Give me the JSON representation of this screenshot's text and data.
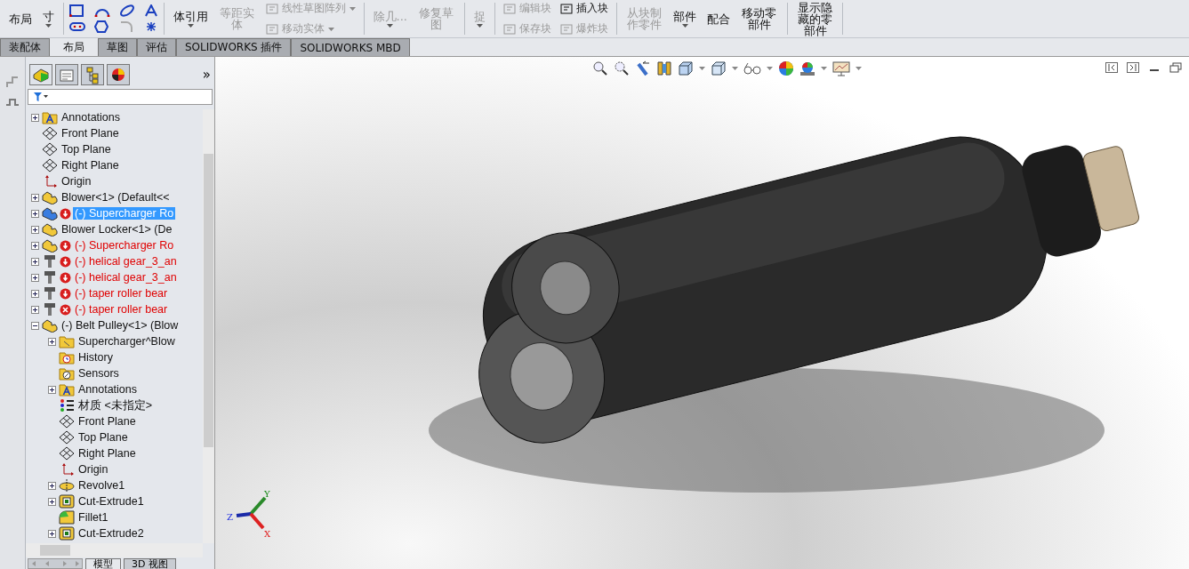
{
  "ribbon": {
    "groups": [
      {
        "items": [
          {
            "kind": "large",
            "label": "布局",
            "disabled": false,
            "dropdown": false
          },
          {
            "kind": "large",
            "label": "寸",
            "disabled": false,
            "dropdown": true
          }
        ]
      },
      {
        "items": [
          {
            "kind": "sketch-icons"
          }
        ]
      },
      {
        "items": [
          {
            "kind": "large",
            "label": "体引用",
            "disabled": false,
            "dropdown": true
          },
          {
            "kind": "large",
            "label": "等距实体",
            "disabled": true,
            "dropdown": false
          },
          {
            "kind": "small",
            "label": "线性草图阵列",
            "disabled": true,
            "dropdown": true
          },
          {
            "kind": "small",
            "label": "移动实体",
            "disabled": true,
            "dropdown": true
          }
        ]
      },
      {
        "items": [
          {
            "kind": "large",
            "label": "除几...",
            "disabled": true,
            "dropdown": true
          },
          {
            "kind": "large",
            "label": "修复草图",
            "disabled": true,
            "dropdown": false
          }
        ]
      },
      {
        "items": [
          {
            "kind": "large",
            "label": "捉",
            "disabled": true,
            "dropdown": true
          }
        ]
      },
      {
        "items": [
          {
            "kind": "small",
            "label": "编辑块",
            "disabled": true,
            "dropdown": false
          },
          {
            "kind": "small",
            "label": "保存块",
            "disabled": true,
            "dropdown": false
          },
          {
            "kind": "small",
            "label": "插入块",
            "disabled": false,
            "dropdown": false
          },
          {
            "kind": "small",
            "label": "爆炸块",
            "disabled": true,
            "dropdown": false
          }
        ]
      },
      {
        "items": [
          {
            "kind": "large",
            "label": "从块制作零件",
            "disabled": true,
            "dropdown": false
          },
          {
            "kind": "large",
            "label": "部件",
            "disabled": false,
            "dropdown": true
          },
          {
            "kind": "large",
            "label": "配合",
            "disabled": false,
            "dropdown": false
          },
          {
            "kind": "large",
            "label": "移动零部件",
            "disabled": false,
            "dropdown": false
          }
        ]
      },
      {
        "items": [
          {
            "kind": "large",
            "label": "显示隐藏的零部件",
            "disabled": false,
            "dropdown": false
          }
        ]
      }
    ]
  },
  "tabs": [
    {
      "label": "装配体",
      "selected": false
    },
    {
      "label": "布局",
      "selected": true
    },
    {
      "label": "草图",
      "selected": false
    },
    {
      "label": "评估",
      "selected": false
    },
    {
      "label": "SOLIDWORKS 插件",
      "selected": false
    },
    {
      "label": "SOLIDWORKS MBD",
      "selected": false
    }
  ],
  "panel": {
    "more": "»",
    "tree": [
      {
        "label": "Annotations",
        "kind": "annotations",
        "expanded": false,
        "selected": false,
        "warning": false,
        "error": false
      },
      {
        "label": "Front Plane",
        "kind": "plane",
        "selected": false,
        "warning": false,
        "error": false
      },
      {
        "label": "Top Plane",
        "kind": "plane",
        "selected": false,
        "warning": false,
        "error": false
      },
      {
        "label": "Right Plane",
        "kind": "plane",
        "selected": false,
        "warning": false,
        "error": false
      },
      {
        "label": "Origin",
        "kind": "origin",
        "selected": false,
        "warning": false,
        "error": false
      },
      {
        "label": "Blower<1> (Default<<",
        "kind": "part",
        "expanded": false,
        "selected": false,
        "warning": false,
        "error": false
      },
      {
        "label": "(-) Supercharger Ro",
        "kind": "part",
        "expanded": false,
        "selected": true,
        "warning": true,
        "error": false
      },
      {
        "label": "Blower Locker<1> (De",
        "kind": "part",
        "expanded": false,
        "selected": false,
        "warning": false,
        "error": false
      },
      {
        "label": "(-) Supercharger Ro",
        "kind": "part",
        "expanded": false,
        "selected": false,
        "warning": true,
        "error": false
      },
      {
        "label": "(-) helical gear_3_an",
        "kind": "bolt",
        "expanded": false,
        "selected": false,
        "warning": true,
        "error": false
      },
      {
        "label": "(-) helical gear_3_an",
        "kind": "bolt",
        "expanded": false,
        "selected": false,
        "warning": true,
        "error": false
      },
      {
        "label": "(-) taper roller bear",
        "kind": "bolt",
        "expanded": false,
        "selected": false,
        "warning": true,
        "error": false
      },
      {
        "label": "(-) taper roller bear",
        "kind": "bolt",
        "expanded": false,
        "selected": false,
        "warning": false,
        "error": true
      },
      {
        "label": "(-) Belt Pulley<1> (Blow",
        "kind": "part",
        "expanded": true,
        "selected": false,
        "warning": false,
        "error": false,
        "children": [
          {
            "label": "Supercharger^Blow",
            "kind": "folder",
            "expanded": false,
            "selected": false
          },
          {
            "label": "History",
            "kind": "history",
            "selected": false
          },
          {
            "label": "Sensors",
            "kind": "sensors",
            "selected": false
          },
          {
            "label": "Annotations",
            "kind": "annotations",
            "expanded": false,
            "selected": false
          },
          {
            "label": "材质 <未指定>",
            "kind": "material",
            "selected": false
          },
          {
            "label": "Front Plane",
            "kind": "plane",
            "selected": false
          },
          {
            "label": "Top Plane",
            "kind": "plane",
            "selected": false
          },
          {
            "label": "Right Plane",
            "kind": "plane",
            "selected": false
          },
          {
            "label": "Origin",
            "kind": "origin",
            "selected": false
          },
          {
            "label": "Revolve1",
            "kind": "revolve",
            "expanded": false,
            "selected": false
          },
          {
            "label": "Cut-Extrude1",
            "kind": "extrude",
            "expanded": false,
            "selected": false
          },
          {
            "label": "Fillet1",
            "kind": "fillet",
            "selected": false
          },
          {
            "label": "Cut-Extrude2",
            "kind": "extrude",
            "expanded": false,
            "selected": false
          }
        ]
      }
    ]
  },
  "bottom_tabs": [
    {
      "label": "模型",
      "selected": true
    },
    {
      "label": "3D 视图",
      "selected": false
    }
  ],
  "triad": {
    "x": "X",
    "y": "Y",
    "z": "Z"
  }
}
